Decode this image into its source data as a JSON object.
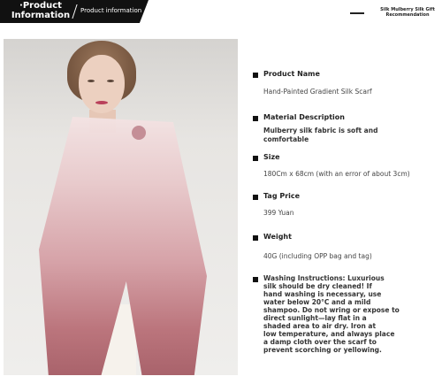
{
  "header": {
    "title_line1": "·Product",
    "title_line2": "Information",
    "subtitle": "Product information",
    "right_line1": "Silk Mulberry Silk Gift",
    "right_line2": "Recommendation"
  },
  "details": [
    {
      "label": "Product Name",
      "value": "Hand-Painted Gradient Silk Scarf"
    },
    {
      "label": "Material Description",
      "value_lines": [
        "Mulberry silk fabric is soft and",
        "comfortable"
      ]
    },
    {
      "label": "Size",
      "value": "180Cm x 68cm (with an error of about 3cm)"
    },
    {
      "label": "Tag Price",
      "value": "399 Yuan"
    },
    {
      "label": "Weight",
      "value": "40G (including OPP bag and tag)"
    }
  ],
  "washing": {
    "lines": [
      "Washing Instructions: Luxurious",
      "silk should be dry cleaned! If",
      "hand washing is necessary, use",
      "water below 20°C and a mild",
      "shampoo. Do not wring or expose to",
      "direct sunlight—lay flat in a",
      "shaded area to air dry. Iron at",
      "low temperature, and always place",
      "a damp cloth over the scarf to",
      "prevent scorching or yellowing."
    ]
  }
}
